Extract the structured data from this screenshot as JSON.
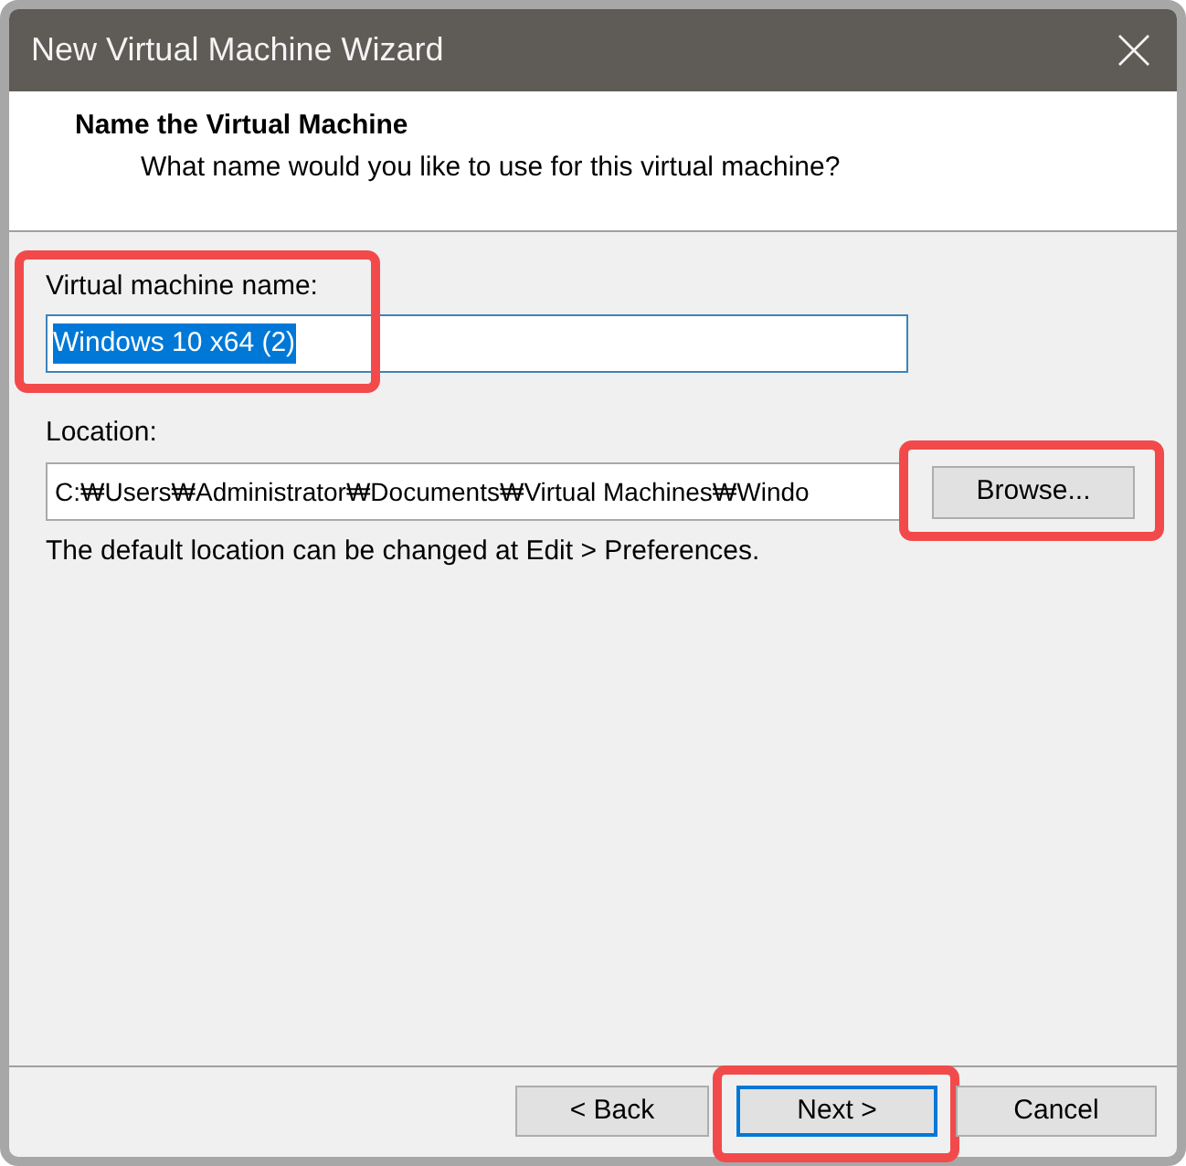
{
  "window": {
    "title": "New Virtual Machine Wizard"
  },
  "header": {
    "title": "Name the Virtual Machine",
    "subtitle": "What name would you like to use for this virtual machine?"
  },
  "name_field": {
    "label": "Virtual machine name:",
    "value": "Windows 10 x64 (2)",
    "text_selected": true,
    "focused": true,
    "highlighted": true
  },
  "location": {
    "label": "Location:",
    "value": "C:₩Users₩Administrator₩Documents₩Virtual Machines₩Windo",
    "browse_button": {
      "label": "Browse...",
      "highlighted": true
    }
  },
  "hint": "The default location can be changed at Edit > Preferences.",
  "buttons": [
    {
      "label": "< Back",
      "focused": false,
      "highlighted": false
    },
    {
      "label": "Next >",
      "focused": true,
      "highlighted": true
    },
    {
      "label": "Cancel",
      "focused": false,
      "highlighted": false
    }
  ]
}
